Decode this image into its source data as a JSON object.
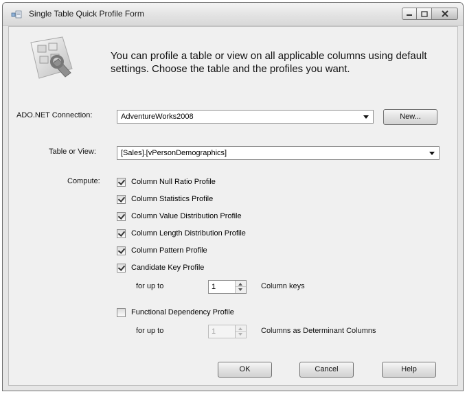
{
  "window": {
    "title": "Single Table Quick Profile Form",
    "icon": "form-icon"
  },
  "header": {
    "icon": "profile-tool-icon",
    "text": "You can profile a table or view on all applicable columns using default settings. Choose the table and the profiles you want."
  },
  "connection": {
    "label": "ADO.NET Connection:",
    "value": "AdventureWorks2008",
    "new_button": "New..."
  },
  "table": {
    "label": "Table or View:",
    "value": "[Sales].[vPersonDemographics]"
  },
  "compute": {
    "label": "Compute:",
    "profiles": [
      {
        "label": "Column Null Ratio Profile",
        "checked": true
      },
      {
        "label": "Column Statistics Profile",
        "checked": true
      },
      {
        "label": "Column Value Distribution Profile",
        "checked": true
      },
      {
        "label": "Column Length Distribution Profile",
        "checked": true
      },
      {
        "label": "Column Pattern Profile",
        "checked": true
      },
      {
        "label": "Candidate Key Profile",
        "checked": true
      }
    ],
    "candidate_key": {
      "for_label": "for up to",
      "value": "1",
      "suffix": "Column keys"
    },
    "functional_dependency": {
      "label": "Functional Dependency Profile",
      "checked": false,
      "for_label": "for up to",
      "value": "1",
      "suffix": "Columns as Determinant Columns"
    }
  },
  "buttons": {
    "ok": "OK",
    "cancel": "Cancel",
    "help": "Help"
  }
}
